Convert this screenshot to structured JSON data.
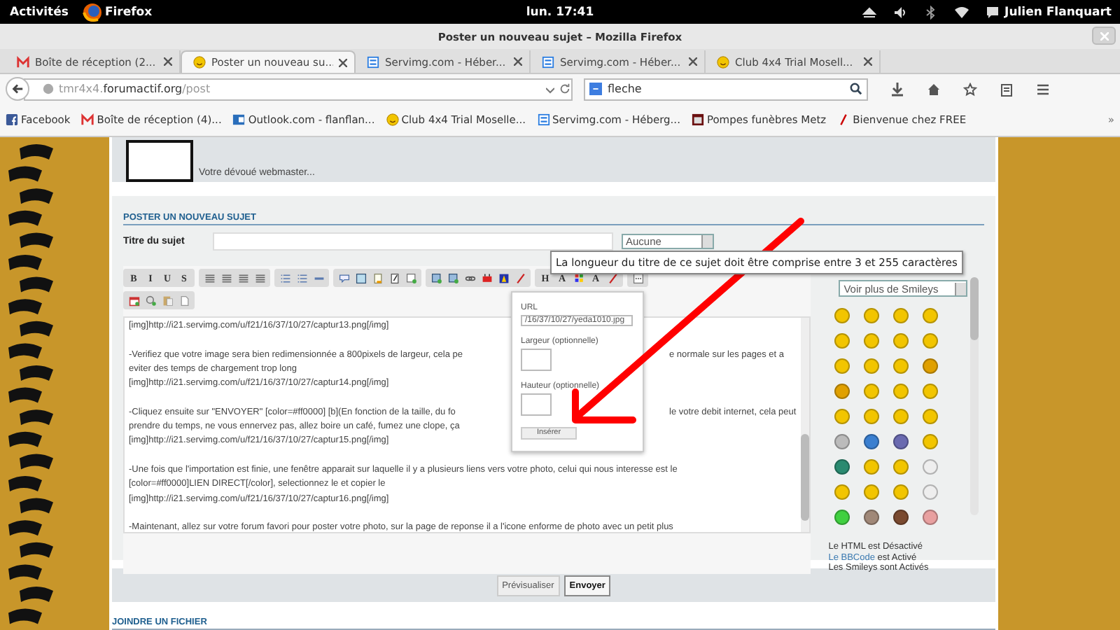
{
  "top_bar": {
    "activities": "Activités",
    "app": "Firefox",
    "clock": "lun. 17:41",
    "user": "Julien Flanquart"
  },
  "window": {
    "title": "Poster un nouveau sujet – Mozilla Firefox"
  },
  "tabs": [
    {
      "label": "Boîte de réception (2...",
      "kind": "mail",
      "selected": false
    },
    {
      "label": "Poster un nouveau su...",
      "kind": "smiley",
      "selected": true
    },
    {
      "label": "Servimg.com - Héber...",
      "kind": "servimg",
      "selected": false
    },
    {
      "label": "Servimg.com - Héber...",
      "kind": "servimg",
      "selected": false
    },
    {
      "label": "Club 4x4 Trial Mosell...",
      "kind": "smiley",
      "selected": false
    }
  ],
  "nav": {
    "url_prefix": "tmr4x4.",
    "url_domain": "forumactif.org",
    "url_path": "/post",
    "search": "fleche"
  },
  "bookmarks": [
    {
      "label": "Facebook",
      "kind": "facebook"
    },
    {
      "label": "Boîte de réception (4)...",
      "kind": "mail"
    },
    {
      "label": "Outlook.com - flanflan...",
      "kind": "outlook"
    },
    {
      "label": "Club 4x4 Trial Moselle...",
      "kind": "smiley"
    },
    {
      "label": "Servimg.com - Héberg...",
      "kind": "servimg"
    },
    {
      "label": "Pompes funèbres Metz",
      "kind": "site"
    },
    {
      "label": "Bienvenue chez FREE",
      "kind": "free"
    }
  ],
  "bookmarks_more": "»",
  "header": {
    "signature": "Votre dévoué webmaster..."
  },
  "form": {
    "heading": "POSTER UN NOUVEAU SUJET",
    "title_label": "Titre du sujet",
    "icon_select": "Aucune",
    "tooltip": "La longueur du titre de ce sujet doit être comprise entre 3 et 255 caractères",
    "toolbar": [
      [
        [
          {
            "kind": "glyph",
            "label": "B"
          },
          {
            "kind": "glyph",
            "label": "I"
          },
          {
            "kind": "glyph",
            "label": "U"
          },
          {
            "kind": "glyph",
            "label": "S"
          }
        ],
        [
          {
            "kind": "align"
          },
          {
            "kind": "align"
          },
          {
            "kind": "align"
          },
          {
            "kind": "align"
          }
        ],
        [
          {
            "kind": "list"
          },
          {
            "kind": "list"
          },
          {
            "kind": "rule"
          }
        ],
        [
          {
            "kind": "speech"
          },
          {
            "kind": "code"
          },
          {
            "kind": "note"
          },
          {
            "kind": "edit"
          },
          {
            "kind": "table"
          }
        ],
        [
          {
            "kind": "image"
          },
          {
            "kind": "image"
          },
          {
            "kind": "link"
          },
          {
            "kind": "video"
          },
          {
            "kind": "flash"
          },
          {
            "kind": "pen"
          }
        ],
        [
          {
            "kind": "glyph",
            "label": "H"
          },
          {
            "kind": "glyph",
            "label": "A"
          },
          {
            "kind": "color"
          },
          {
            "kind": "glyph",
            "label": "A"
          },
          {
            "kind": "pen"
          }
        ],
        [
          {
            "kind": "more"
          }
        ]
      ],
      [
        [
          {
            "kind": "calendar"
          },
          {
            "kind": "search"
          },
          {
            "kind": "paste"
          },
          {
            "kind": "page"
          }
        ]
      ]
    ],
    "editor_paragraphs": [
      [
        {
          "text": "[img]http://i21.servimg.com/u/f21/16/37/10/27/captur13.png[/img]"
        }
      ],
      [
        {
          "text": "-Verifiez que votre image sera bien redimensionnée a 800pixels de largeur, cela pe",
          "after": "e normale sur les pages et a"
        },
        {
          "text": "eviter des temps de chargement trop long"
        },
        {
          "text": "[img]http://i21.servimg.com/u/f21/16/37/10/27/captur14.png[/img]"
        }
      ],
      [
        {
          "text": "-Cliquez ensuite sur \"ENVOYER\" [color=#ff0000] [b](En fonction de la taille, du fo",
          "after": "le votre debit internet, cela peut"
        },
        {
          "text": "prendre du temps, ne vous ennervez pas, allez boire un café, fumez une clope, ça"
        },
        {
          "text": "[img]http://i21.servimg.com/u/f21/16/37/10/27/captur15.png[/img]"
        }
      ],
      [
        {
          "text": "-Une fois que l'importation est finie, une fenêtre apparait sur laquelle il y a plusieurs liens vers votre photo, celui qui nous interesse est le"
        },
        {
          "text": "[color=#ff0000]LIEN DIRECT[/color], selectionnez le et copier le"
        },
        {
          "text": "[img]http://i21.servimg.com/u/f21/16/37/10/27/captur16.png[/img]"
        }
      ],
      [
        {
          "text": "-Maintenant, allez sur votre forum favori pour poster votre photo, sur la page de reponse il a l'icone enforme de photo avec un petit plus"
        }
      ]
    ],
    "image_popup": {
      "url_label": "URL",
      "url_value": "/16/37/10/27/yeda1010.jpg",
      "width_label": "Largeur (optionnelle)",
      "height_label": "Hauteur (optionnelle)",
      "button": "Insérer"
    },
    "smiley_select": "Voir plus de Smileys",
    "smileys": [
      {
        "color": "#f2c500"
      },
      {
        "color": "#f2c500"
      },
      {
        "color": "#f2c500"
      },
      {
        "color": "#f2c500"
      },
      {
        "color": "#f2c500"
      },
      {
        "color": "#f2c500"
      },
      {
        "color": "#f2c500"
      },
      {
        "color": "#f2c500"
      },
      {
        "color": "#f2c500"
      },
      {
        "color": "#f2c500"
      },
      {
        "color": "#f2c500"
      },
      {
        "color": "#e0a000"
      },
      {
        "color": "#e0a000"
      },
      {
        "color": "#f2c500"
      },
      {
        "color": "#f2c500"
      },
      {
        "color": "#f2c500"
      },
      {
        "color": "#f2c500"
      },
      {
        "color": "#f2c500"
      },
      {
        "color": "#f2c500"
      },
      {
        "color": "#f2c500"
      },
      {
        "color": "#bbbbbb"
      },
      {
        "color": "#3a7fd0"
      },
      {
        "color": "#6a6ab0"
      },
      {
        "color": "#f2c500"
      },
      {
        "color": "#2a8a70"
      },
      {
        "color": "#f2c500"
      },
      {
        "color": "#f2c500"
      },
      {
        "color": "#eeeeee"
      },
      {
        "color": "#f2c500"
      },
      {
        "color": "#f2c500"
      },
      {
        "color": "#f2c500"
      },
      {
        "color": "#eeeeee"
      },
      {
        "color": "#40d040"
      },
      {
        "color": "#a08878"
      },
      {
        "color": "#7a4a30"
      },
      {
        "color": "#e8a0a0"
      }
    ],
    "status": [
      {
        "text": "Le HTML est Désactivé"
      },
      {
        "link": "Le BBCode",
        "text": "est Activé"
      },
      {
        "text": "Les Smileys sont Activés"
      }
    ],
    "buttons": [
      {
        "label": "Prévisualiser",
        "primary": false
      },
      {
        "label": "Envoyer",
        "primary": true
      }
    ]
  },
  "attach": {
    "heading": "JOINDRE UN FICHIER"
  }
}
